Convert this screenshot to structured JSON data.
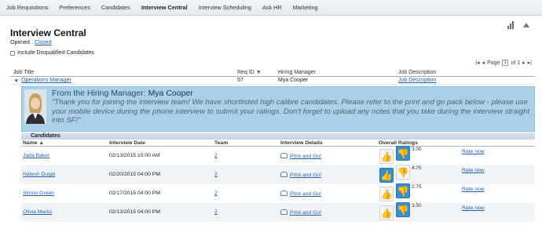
{
  "nav": [
    "Job Requisitions",
    "Preferences",
    "Candidates",
    "Interview Central",
    "Interview Scheduling",
    "Ask HR",
    "Marketing"
  ],
  "nav_active": "Interview Central",
  "page": {
    "title": "Interview Central",
    "status_opened": "Opened",
    "status_closed": "Closed",
    "include_disqualified": "Include Disqualified Candidates"
  },
  "pager": {
    "page_label": "Page",
    "page_value": "1",
    "of_label": "of 1"
  },
  "requisitions": {
    "headers": {
      "job_title": "Job Title",
      "req_id": "Req ID",
      "hiring_manager": "Hiring Manager",
      "job_description": "Job Description"
    },
    "row": {
      "job_title": "Operations Manager",
      "req_id": "57",
      "hiring_manager": "Mya Cooper",
      "job_description": "Job Description"
    }
  },
  "message": {
    "title_prefix": "From the Hiring Manager:",
    "manager_name": "Mya Cooper",
    "text": "\"Thank you for joining the interview team! We have shortlisted high calibre candidates. Please refer to the print and go pack below - please use your mobile device during the phone interview to submit your ratings. Don't forget to upload any notes that you take during the interview straight into SF!\""
  },
  "candidates": {
    "section_title": "Candidates",
    "headers": {
      "name": "Name",
      "interview_date": "Interview Date",
      "team": "Team",
      "interview_details": "Interview Details",
      "overall_ratings": "Overall Ratings"
    },
    "rows": [
      {
        "name": "Jada Baker",
        "date": "02/13/2015 10:00 AM",
        "team": "2",
        "details": "Print and Go!",
        "rating": "3.00",
        "thumb": "down",
        "rate_label": "Rate now"
      },
      {
        "name": "Natesh Dugal",
        "date": "02/20/2015 04:00 PM",
        "team": "2",
        "details": "Print and Go!",
        "rating": "4.75",
        "thumb": "up",
        "rate_label": "Rate now"
      },
      {
        "name": "Simon Green",
        "date": "02/17/2015 04:00 PM",
        "team": "2",
        "details": "Print and Go!",
        "rating": "2.75",
        "thumb": "down",
        "rate_label": "Rate now"
      },
      {
        "name": "Olivia Marks",
        "date": "02/13/2015 04:00 PM",
        "team": "2",
        "details": "Print and Go!",
        "rating": "3.50",
        "thumb": "down",
        "rate_label": "Rate now"
      }
    ]
  },
  "colors": {
    "accent": "#3b8fca",
    "link": "#1f5fa8",
    "callout_bg": "#a9d2ea"
  },
  "icons": {
    "sort_asc": "triangle-up-icon",
    "sort_desc": "triangle-down-icon",
    "expand": "triangle-down-icon",
    "thumb_up": "thumbs-up-icon",
    "thumb_down": "thumbs-down-icon",
    "print": "phone-icon",
    "chart": "bar-chart-icon"
  }
}
